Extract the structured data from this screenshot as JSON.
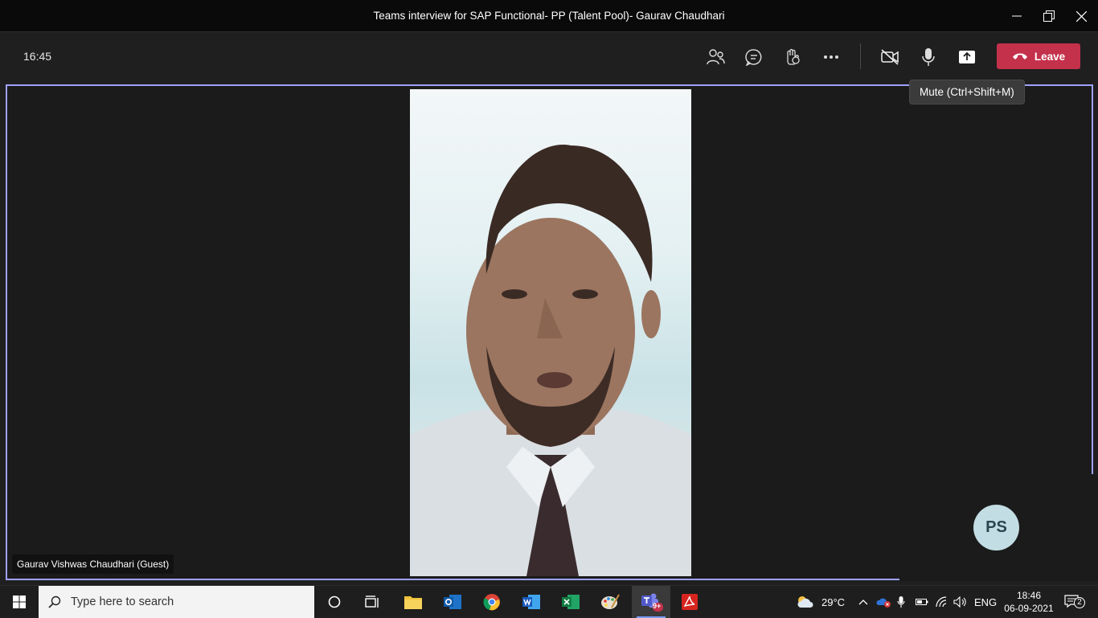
{
  "window": {
    "title": "Teams interview for SAP Functional- PP (Talent Pool)- Gaurav Chaudhari"
  },
  "toolbar": {
    "timer": "16:45",
    "leave_label": "Leave",
    "tooltip": "Mute (Ctrl+Shift+M)"
  },
  "stage": {
    "participant_name": "Gaurav Vishwas Chaudhari (Guest)"
  },
  "self_view": {
    "initials": "PS"
  },
  "taskbar": {
    "search_placeholder": "Type here to search",
    "teams_badge": "9+",
    "weather": "29°C",
    "language": "ENG",
    "time": "18:46",
    "date": "06-09-2021",
    "notification_count": "2"
  },
  "colors": {
    "leave": "#c4314b",
    "stage_border": "#9ea2ff",
    "accent": "#7a9cff"
  }
}
